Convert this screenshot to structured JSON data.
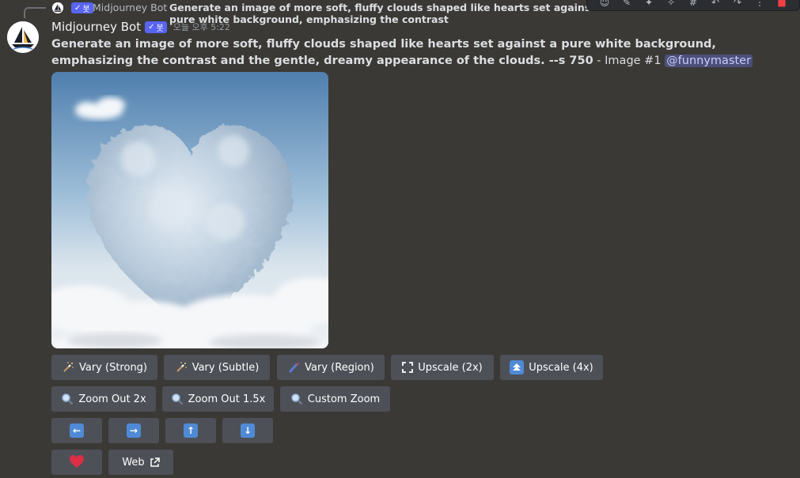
{
  "reply": {
    "bot_name": "Midjourney Bot",
    "text": "Generate an image of more soft, fluffy clouds shaped like hearts set against a pure white background, emphasizing the contrast"
  },
  "author": {
    "name": "Midjourney Bot",
    "bot_tag": "봇",
    "timestamp": "오늘 오후 5:22"
  },
  "message": {
    "prompt": "Generate an image of more soft, fluffy clouds shaped like hearts set against a pure white background, emphasizing the contrast and the gentle, dreamy appearance of the clouds. --s 750",
    "separator": " - ",
    "image_label": "Image #1",
    "mention": "@funnymaster"
  },
  "buttons": {
    "row1": [
      {
        "label": "Vary (Strong)",
        "icon": "magic-wand-icon"
      },
      {
        "label": "Vary (Subtle)",
        "icon": "magic-wand-icon"
      },
      {
        "label": "Vary (Region)",
        "icon": "paintbrush-icon"
      },
      {
        "label": "Upscale (2x)",
        "icon": "expand-icon"
      },
      {
        "label": "Upscale (4x)",
        "icon": "double-up-arrow-icon"
      }
    ],
    "row2": [
      {
        "label": "Zoom Out 2x",
        "icon": "magnifier-icon"
      },
      {
        "label": "Zoom Out 1.5x",
        "icon": "magnifier-icon"
      },
      {
        "label": "Custom Zoom",
        "icon": "magnifier-icon"
      }
    ],
    "row3": [
      {
        "icon": "arrow-left-icon",
        "glyph": "←"
      },
      {
        "icon": "arrow-right-icon",
        "glyph": "→"
      },
      {
        "icon": "arrow-up-icon",
        "glyph": "↑"
      },
      {
        "icon": "arrow-down-icon",
        "glyph": "↓"
      }
    ],
    "row4": [
      {
        "icon": "heart-icon"
      },
      {
        "label": "Web",
        "icon": "external-link-icon"
      }
    ]
  },
  "colors": {
    "background": "#3b3936",
    "button": "#4e5058",
    "bot_tag": "#5865f2",
    "mention_bg": "#4b4f7a",
    "heart": "#dd2e44",
    "arrow_icon_bg": "#4f8ad6"
  }
}
